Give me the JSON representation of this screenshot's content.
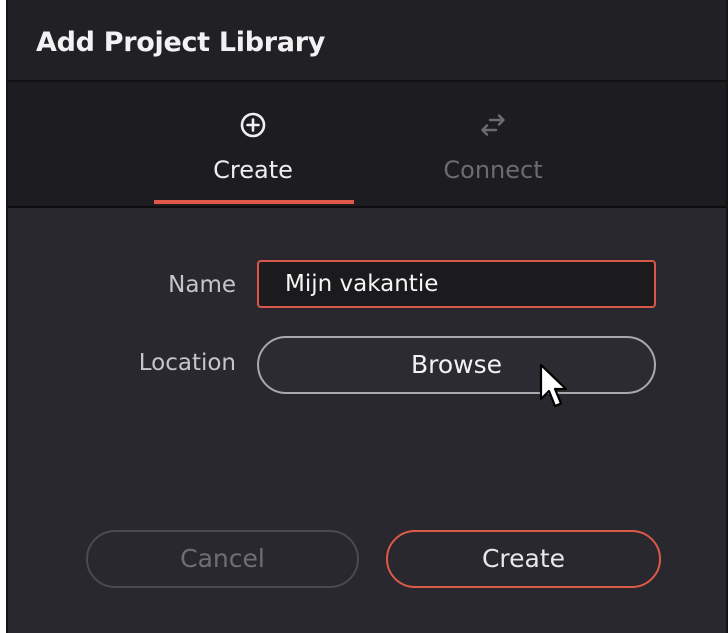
{
  "dialog": {
    "title": "Add Project Library"
  },
  "tabs": [
    {
      "label": "Create",
      "icon": "plus-circle-icon",
      "active": true
    },
    {
      "label": "Connect",
      "icon": "swap-arrows-icon",
      "active": false
    }
  ],
  "form": {
    "name_label": "Name",
    "name_value": "Mijn vakantie",
    "location_label": "Location",
    "browse_label": "Browse"
  },
  "footer": {
    "cancel_label": "Cancel",
    "create_label": "Create"
  },
  "colors": {
    "accent": "#e05a48",
    "background": "#28282e",
    "titlebar": "#202025",
    "tabbar": "#1d1d21"
  }
}
